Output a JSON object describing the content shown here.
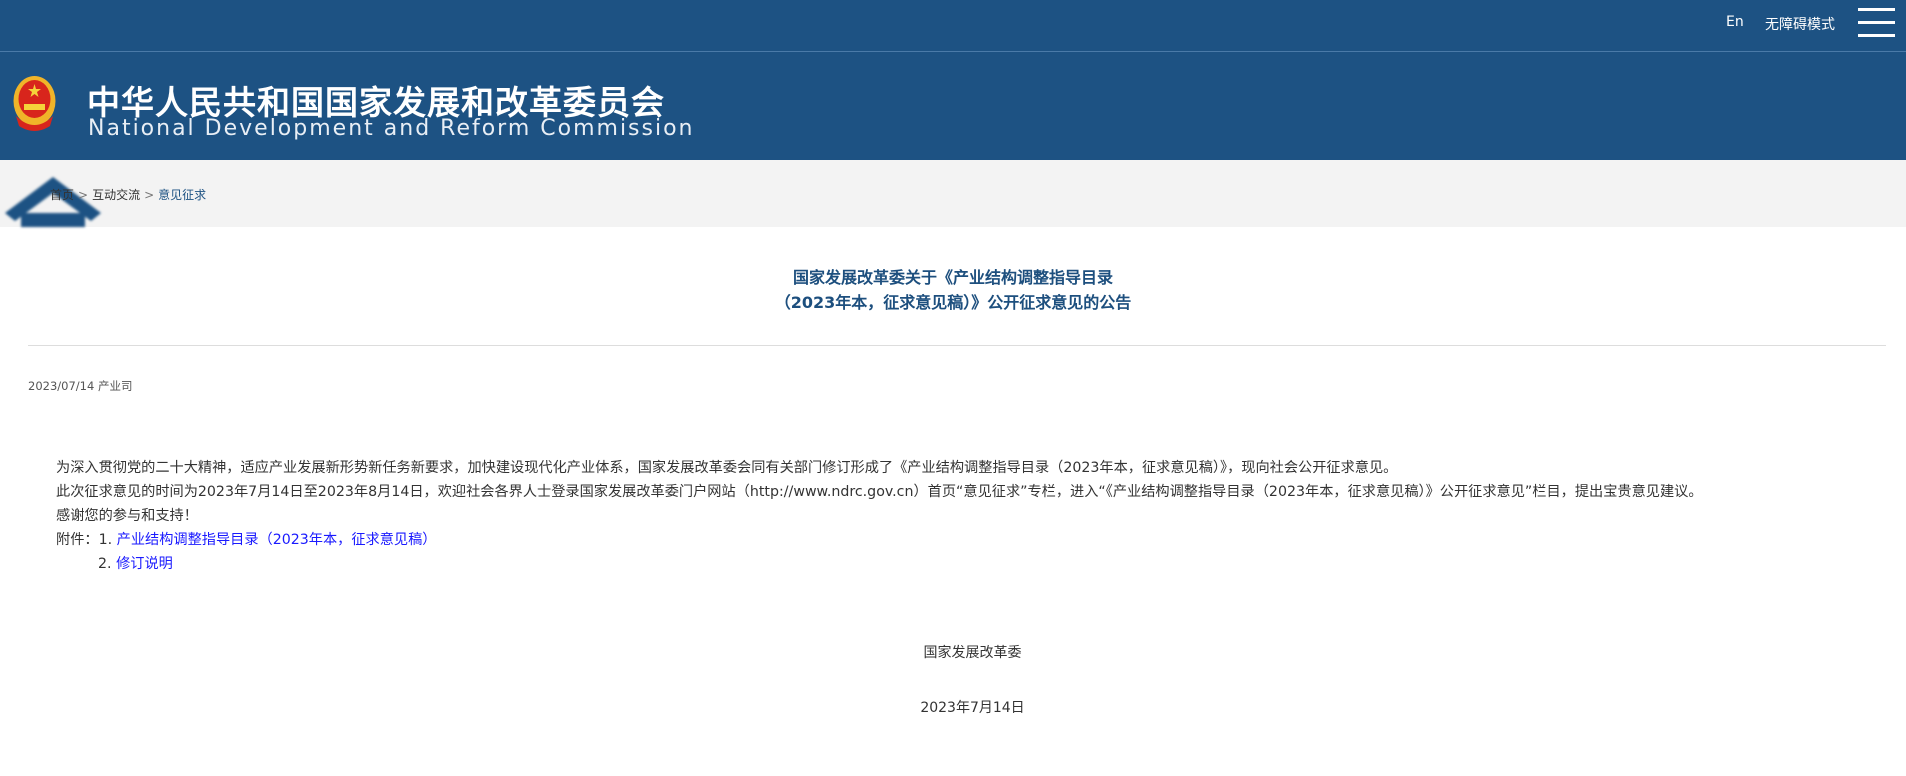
{
  "topbar": {
    "lang_label": "En",
    "accessibility_label": "无障碍模式"
  },
  "header": {
    "title_cn": "中华人民共和国国家发展和改革委员会",
    "title_en": "National Development and Reform Commission"
  },
  "breadcrumb": {
    "items": [
      "首页",
      "互动交流",
      "意见征求"
    ],
    "separator": ">"
  },
  "article": {
    "title_line1": "国家发展改革委关于《产业结构调整指导目录",
    "title_line2": "（2023年本，征求意见稿）》公开征求意见的公告",
    "date": "2023/07/14",
    "department": "产业司",
    "paragraphs": [
      "为深入贯彻党的二十大精神，适应产业发展新形势新任务新要求，加快建设现代化产业体系，国家发展改革委会同有关部门修订形成了《产业结构调整指导目录（2023年本，征求意见稿）》，现向社会公开征求意见。",
      "此次征求意见的时间为2023年7月14日至2023年8月14日，欢迎社会各界人士登录国家发展改革委门户网站（http://www.ndrc.gov.cn）首页“意见征求”专栏，进入“《产业结构调整指导目录（2023年本，征求意见稿）》公开征求意见”栏目，提出宝贵意见建议。",
      "感谢您的参与和支持！"
    ],
    "attachments_label": "附件：",
    "attachments": [
      {
        "num": "1.",
        "label": "产业结构调整指导目录（2023年本，征求意见稿）"
      },
      {
        "num": "2.",
        "label": "修订说明"
      }
    ],
    "signature": "国家发展改革委",
    "sign_date": "2023年7月14日"
  },
  "colors": {
    "brand": "#1d5283",
    "link": "#1a1aff"
  }
}
